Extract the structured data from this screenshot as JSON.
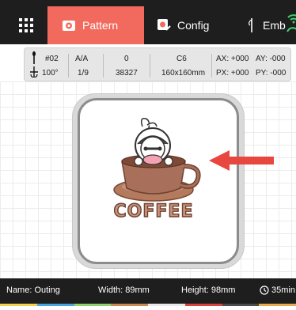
{
  "tabs": [
    {
      "label": "Pattern",
      "active": true
    },
    {
      "label": "Config",
      "active": false
    },
    {
      "label": "Emb",
      "active": false
    }
  ],
  "info": {
    "needle": "#02",
    "angle": "100°",
    "aa": "A/A",
    "fraction": "1/9",
    "zero": "0",
    "stitches": "38327",
    "hoop_code": "C6",
    "hoop_size": "160x160mm",
    "ax": "AX: +000",
    "ay": "AY: -000",
    "px": "PX: +000",
    "py": "PY: -000"
  },
  "design": {
    "text": "COFFEE"
  },
  "status": {
    "name": "Name: Outing",
    "width": "Width: 89mm",
    "height": "Height: 98mm",
    "time": "35min"
  },
  "colors": {
    "accent": "#f26a5e",
    "dark": "#1e1e1e",
    "arrow": "#e8473f",
    "thread_bar": [
      "#f2d14b",
      "#4aa3e0",
      "#8fd16a",
      "#c98a52",
      "#e8e8e8",
      "#d6443b",
      "#4a4a4a",
      "#e8a94f"
    ]
  }
}
